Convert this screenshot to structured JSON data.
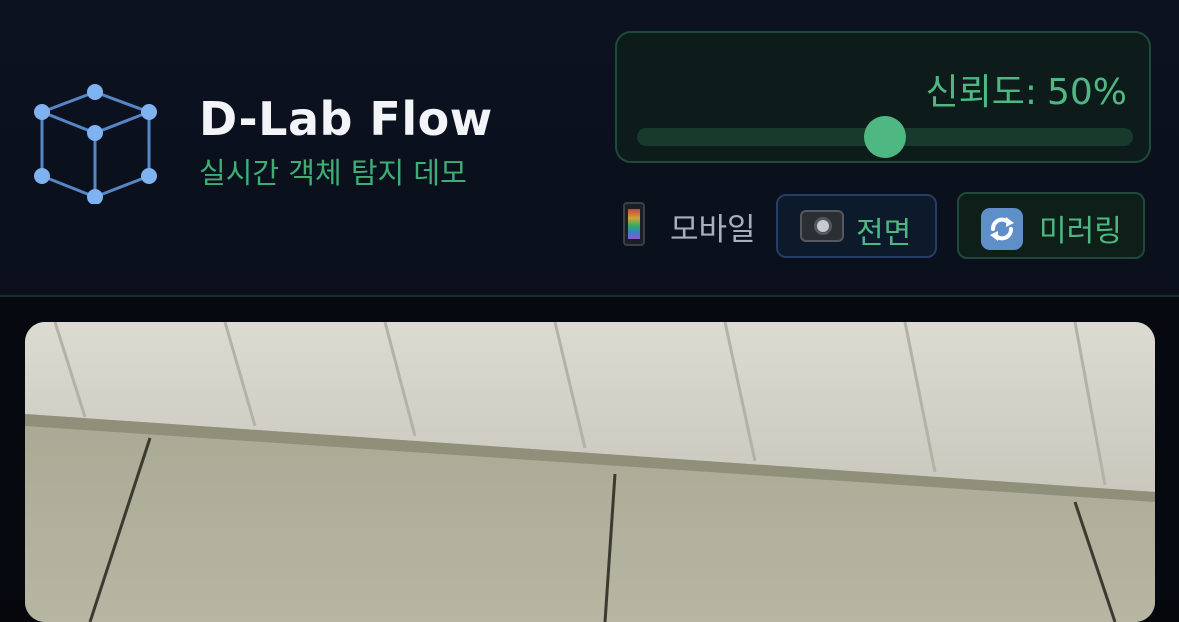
{
  "header": {
    "title": "D-Lab Flow",
    "subtitle": "실시간 객체 탐지 데모",
    "logo_icon": "cube-network-icon"
  },
  "confidence": {
    "label": "신뢰도:",
    "value_text": "50%",
    "value": 50,
    "min": 0,
    "max": 100
  },
  "device": {
    "icon": "mobile-phone-icon",
    "label": "모바일"
  },
  "buttons": {
    "front": {
      "icon": "camera-icon",
      "label": "전면"
    },
    "mirror": {
      "icon": "mirror-refresh-icon",
      "label": "미러링"
    }
  },
  "colors": {
    "accent": "#4fb882",
    "background": "#0a0f1b",
    "title": "#f2f4f7"
  }
}
